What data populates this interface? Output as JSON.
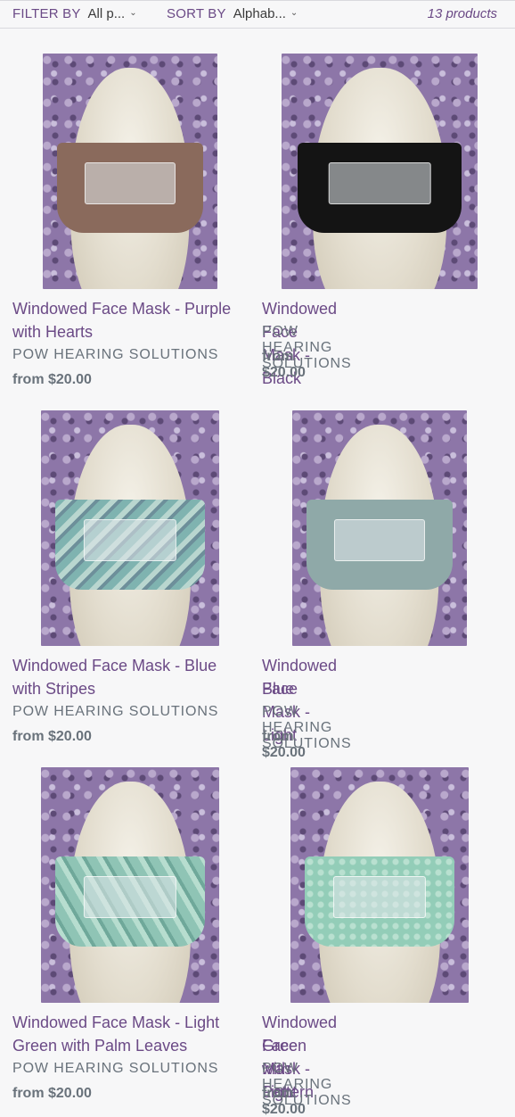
{
  "toolbar": {
    "filter_label": "FILTER BY",
    "filter_value": "All p...",
    "sort_label": "SORT BY",
    "sort_value": "Alphab...",
    "product_count": "13 products",
    "chevron_icon": "chevron-down-icon"
  },
  "products": [
    {
      "title": "Windowed Face Mask - Purple with Hearts",
      "title_line1": "Windowed Face Mask - Purple",
      "title_line2": "with Hearts",
      "vendor": "POW HEARING SOLUTIONS",
      "price": "from $20.00",
      "mask_color": "#8a6a5c"
    },
    {
      "title": "Windowed Face Mask - Black",
      "title_line1": "Windowed Face Mask - Black",
      "title_line2": "",
      "vendor": "POW HEARING SOLUTIONS",
      "price": "from $20.00",
      "mask_color": "#141414"
    },
    {
      "title": "Windowed Face Mask - Blue with Stripes",
      "title_line1": "Windowed Face Mask - Blue",
      "title_line2": "with Stripes",
      "vendor": "POW HEARING SOLUTIONS",
      "price": "from $20.00",
      "mask_color": "#7fb3b0"
    },
    {
      "title": "Windowed Face Mask - Light Blue",
      "title_line1": "Windowed Face Mask - Light",
      "title_line2": "Blue",
      "vendor": "POW HEARING SOLUTIONS",
      "price": "from $20.00",
      "mask_color": "#8fa9a8"
    },
    {
      "title": "Windowed Face Mask - Light Green with Palm Leaves",
      "title_line1": "Windowed Face Mask - Light",
      "title_line2": "Green with Palm Leaves",
      "vendor": "POW HEARING SOLUTIONS",
      "price": "from $20.00",
      "mask_color": "#8fc4b5"
    },
    {
      "title": "Windowed Face Mask - Light Green with Pattern",
      "title_line1": "Windowed Face Mask - Light",
      "title_line2": "Green with Pattern",
      "vendor": "POW HEARING SOLUTIONS",
      "price": "from $20.00",
      "mask_color": "#93cdb8"
    }
  ]
}
